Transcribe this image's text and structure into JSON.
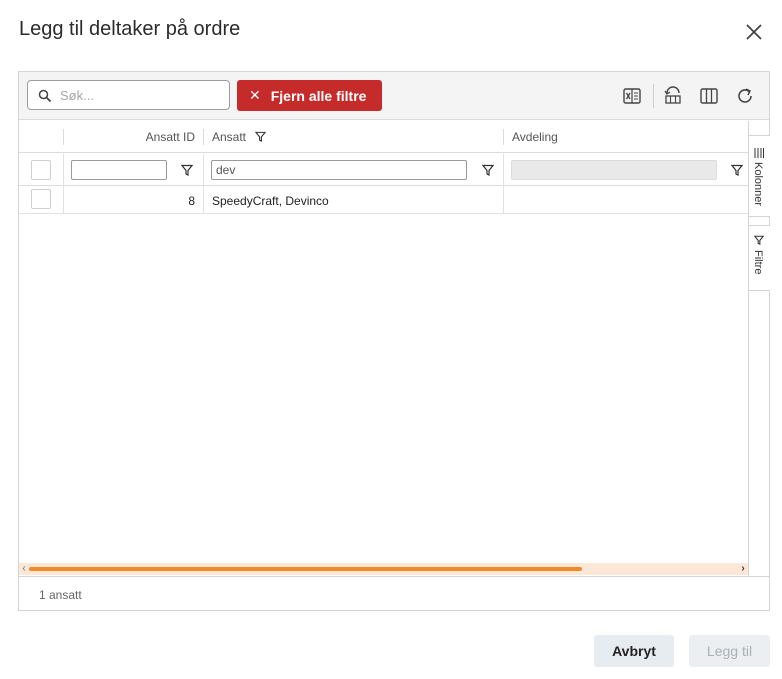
{
  "dialog": {
    "title": "Legg til deltaker på ordre",
    "close_icon": "close-icon"
  },
  "toolbar": {
    "search_placeholder": "Søk...",
    "search_value": "",
    "clear_filters_label": "Fjern alle filtre",
    "icons": [
      "excel-export-icon",
      "reset-layout-icon",
      "columns-icon",
      "refresh-icon"
    ]
  },
  "table": {
    "columns": [
      {
        "label": "Ansatt ID",
        "filter_value": ""
      },
      {
        "label": "Ansatt",
        "filter_value": "dev",
        "filtered": true
      },
      {
        "label": "Avdeling",
        "filter_value": ""
      }
    ],
    "rows": [
      {
        "id": "8",
        "name": "SpeedyCraft, Devinco",
        "department": ""
      }
    ]
  },
  "sidebar": {
    "columns_label": "Kolonner",
    "filters_label": "Filtre"
  },
  "footer": {
    "count_text": "1 ansatt"
  },
  "actions": {
    "cancel_label": "Avbryt",
    "add_label": "Legg til"
  },
  "colors": {
    "clear_button": "#c52b2b",
    "scroll_thumb": "#f28b27",
    "scroll_track": "#fde8d7"
  }
}
